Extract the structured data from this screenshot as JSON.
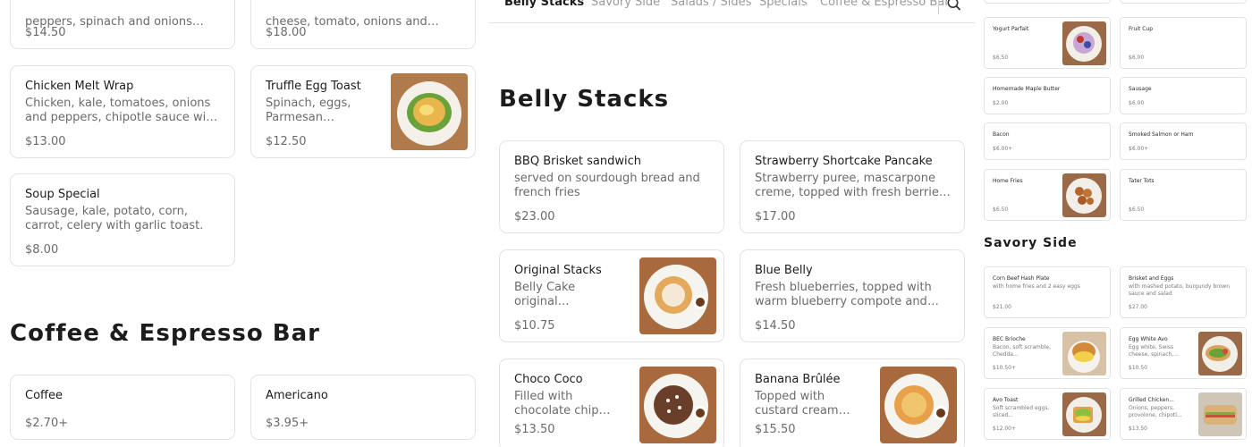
{
  "left": {
    "top_cards": [
      {
        "desc": "peppers, spinach and onions with...",
        "price": "$14.50"
      },
      {
        "desc": "cheese, tomato, onions and greens,...",
        "price": "$18.00"
      }
    ],
    "cards": [
      {
        "name": "Chicken Melt Wrap",
        "desc": "Chicken, kale, tomatoes, onions and peppers, chipotle sauce with Chedda...",
        "price": "$13.00"
      },
      {
        "name": "Truffle Egg Toast",
        "desc": "Spinach, eggs, Parmesan cheese,...",
        "price": "$12.50"
      },
      {
        "name": "Soup Special",
        "desc": "Sausage, kale, potato, corn, carrot, celery with garlic toast.",
        "price": "$8.00"
      }
    ],
    "section_title": "Coffee & Espresso Bar",
    "coffee_cards": [
      {
        "name": "Coffee",
        "price": "$2.70+"
      },
      {
        "name": "Americano",
        "price": "$3.95+"
      }
    ]
  },
  "nav": {
    "tabs": [
      "Belly Stacks",
      "Savory Side",
      "Salads / Sides",
      "Specials",
      "Coffee & Espresso Bar"
    ],
    "active": "Belly Stacks",
    "search_icon": "search-icon"
  },
  "middle": {
    "section_title": "Belly Stacks",
    "cards": [
      {
        "name": "BBQ Brisket sandwich",
        "desc": "served on sourdough bread and french fries",
        "price": "$23.00"
      },
      {
        "name": "Strawberry Shortcake Pancake",
        "desc": "Strawberry puree, mascarpone creme, topped with fresh berries with maple...",
        "price": "$17.00"
      },
      {
        "name": "Original Stacks",
        "desc": "Belly Cake original pancakes and ma...",
        "price": "$10.75"
      },
      {
        "name": "Blue Belly",
        "desc": "Fresh blueberries, topped with warm blueberry compote and maple butter...",
        "price": "$14.50"
      },
      {
        "name": "Choco Coco",
        "desc": "Filled with chocolate chips and dipped i...",
        "price": "$13.50"
      },
      {
        "name": "Banana Brûlée",
        "desc": "Topped with custard cream, bananas a...",
        "price": "$15.50"
      }
    ]
  },
  "right": {
    "sides": [
      {
        "name": "Yogurt Parfait",
        "price": "$6.50"
      },
      {
        "name": "Fruit Cup",
        "price": "$6.00"
      },
      {
        "name": "Homemade Maple Butter",
        "price": "$2.00"
      },
      {
        "name": "Sausage",
        "price": "$6.00"
      },
      {
        "name": "Bacon",
        "price": "$6.00+"
      },
      {
        "name": "Smoked Salmon or Ham",
        "price": "$6.00+"
      },
      {
        "name": "Home Fries",
        "price": "$6.50"
      },
      {
        "name": "Tater Tots",
        "price": "$6.50"
      }
    ],
    "section_title": "Savory Side",
    "savory": [
      {
        "name": "Corn Beef Hash Plate",
        "desc": "with home fries and 2 easy eggs",
        "price": "$21.00"
      },
      {
        "name": "Brisket and Eggs",
        "desc": "with mashed potato, burgundy brown sauce and salad",
        "price": "$27.00"
      },
      {
        "name": "BEC Brioche",
        "desc": "Bacon, soft scramble, Chedda...",
        "price": "$10.50+"
      },
      {
        "name": "Egg White Avo",
        "desc": "Egg white, Swiss cheese, spinach,...",
        "price": "$10.50"
      },
      {
        "name": "Avo Toast",
        "desc": "Soft scrambled eggs, sliced...",
        "price": "$12.00+"
      },
      {
        "name": "Grilled Chicken...",
        "desc": "Onions, peppers, provolone, chipotl...",
        "price": "$13.50"
      }
    ]
  },
  "colors": {
    "border": "#e3e3e3",
    "text": "#1c1c1c",
    "muted": "#6b6b6b",
    "tab_muted": "#9a9a9a"
  }
}
